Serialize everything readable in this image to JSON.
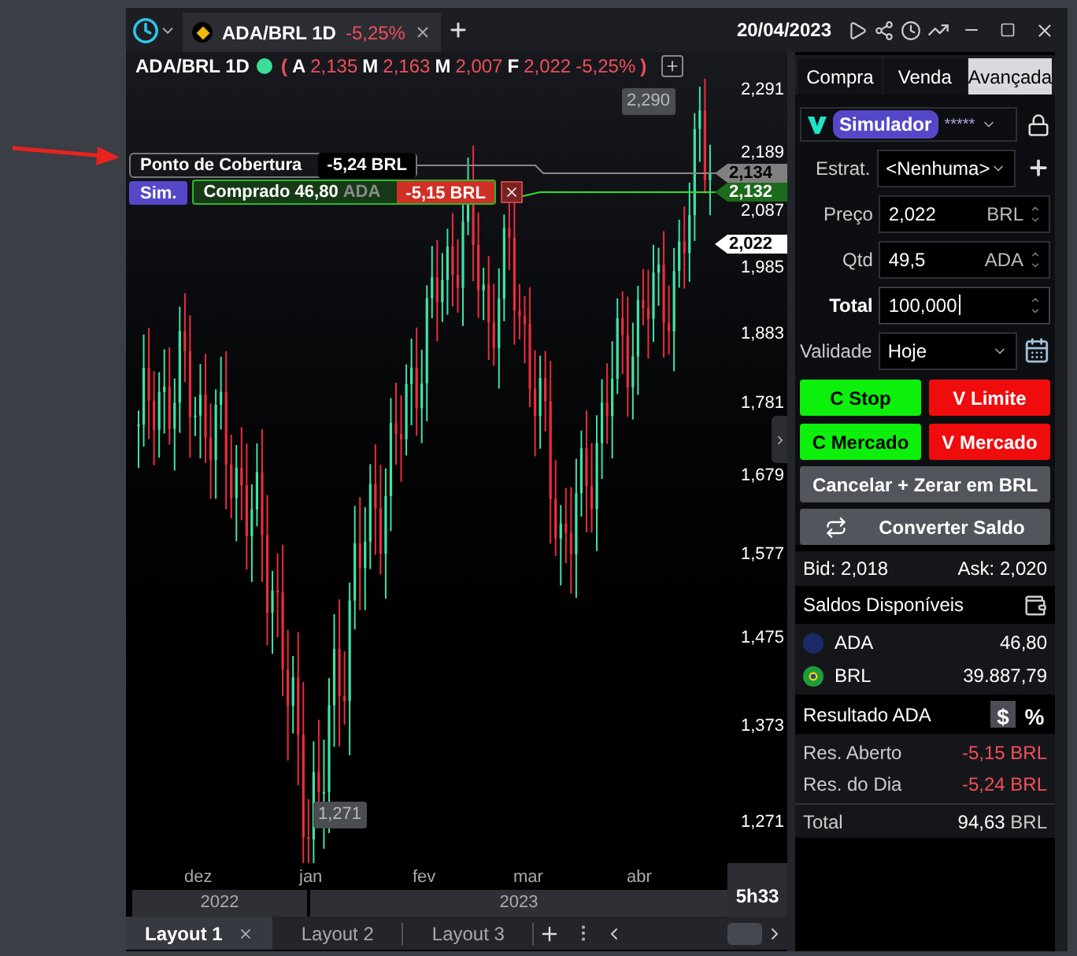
{
  "window": {
    "tabs": [
      {
        "label": "ADA/BRL 1D",
        "change": "-5,25%",
        "selected": true
      }
    ],
    "date": "20/04/2023"
  },
  "chart": {
    "header": {
      "symbol": "ADA/BRL 1D",
      "connected": true,
      "open_paren": "(",
      "ohlc": [
        {
          "label": "A",
          "value": "2,135"
        },
        {
          "label": "M",
          "value": "2,163"
        },
        {
          "label": "M",
          "value": "2,007"
        },
        {
          "label": "F",
          "value": "2,022"
        }
      ],
      "change": "-5,25%",
      "close_paren": ")"
    },
    "high_marker": "2,290",
    "low_marker": "1,271",
    "break_even": {
      "label": "Ponto de Cobertura",
      "value": "-5,24 BRL"
    },
    "position": {
      "mode": "Sim.",
      "label": "Comprado 46,80",
      "unit": "ADA",
      "pnl": "-5,15 BRL"
    },
    "price_tags": [
      {
        "value": "2,134",
        "kind": "breakeven"
      },
      {
        "value": "2,132",
        "kind": "position"
      },
      {
        "value": "2,022",
        "kind": "last"
      }
    ],
    "y_ticks": [
      "2,291",
      "2,189",
      "2,087",
      "1,985",
      "1,883",
      "1,781",
      "1,679",
      "1,577",
      "1,475",
      "1,373",
      "1,271"
    ],
    "months": [
      "dez",
      "jan",
      "fev",
      "mar",
      "abr"
    ],
    "years": [
      "2022",
      "2023"
    ],
    "countdown": "5h33"
  },
  "layouts": [
    {
      "label": "Layout 1",
      "selected": true
    },
    {
      "label": "Layout 2",
      "selected": false
    },
    {
      "label": "Layout 3",
      "selected": false
    }
  ],
  "panel": {
    "tabs": [
      {
        "label": "Compra",
        "selected": false
      },
      {
        "label": "Venda",
        "selected": false
      },
      {
        "label": "Avançada",
        "selected": true
      }
    ],
    "account": {
      "name": "Simulador",
      "masked": "*****"
    },
    "fields": [
      {
        "kind": "strategy",
        "label": "Estrat.",
        "value": "<Nenhuma>"
      },
      {
        "kind": "spin",
        "label": "Preço",
        "value": "2,022",
        "unit": "BRL",
        "focused": false
      },
      {
        "kind": "spin",
        "label": "Qtd",
        "value": "49,5",
        "unit": "ADA",
        "focused": false
      },
      {
        "kind": "spin",
        "label": "Total",
        "value": "100,000",
        "focused": true
      },
      {
        "kind": "validity",
        "label": "Validade",
        "value": "Hoje"
      }
    ],
    "orders": [
      {
        "label": "C Stop",
        "kind": "buy"
      },
      {
        "label": "V Limite",
        "kind": "sell"
      },
      {
        "label": "C Mercado",
        "kind": "buy"
      },
      {
        "label": "V Mercado",
        "kind": "sell"
      }
    ],
    "actions": [
      {
        "label": "Cancelar + Zerar em BRL",
        "kind": "plain"
      },
      {
        "label": "Converter Saldo",
        "kind": "convert"
      }
    ],
    "quote": {
      "bid_label": "Bid:",
      "bid": "2,018",
      "ask_label": "Ask:",
      "ask": "2,020"
    },
    "balances": {
      "title": "Saldos Disponíveis",
      "items": [
        {
          "asset": "ADA",
          "amount": "46,80",
          "kind": "crypto"
        },
        {
          "asset": "BRL",
          "amount": "39.887,79",
          "kind": "fiat"
        }
      ]
    },
    "result": {
      "title": "Resultado ADA",
      "modes": [
        {
          "label": "$",
          "selected": true
        },
        {
          "label": "%",
          "selected": false
        }
      ],
      "rows": [
        {
          "label": "Res. Aberto",
          "value": "-5,15 BRL"
        },
        {
          "label": "Res. do Dia",
          "value": "-5,24 BRL"
        }
      ]
    },
    "total": {
      "label": "Total",
      "value": "94,63",
      "unit": "BRL"
    }
  }
}
